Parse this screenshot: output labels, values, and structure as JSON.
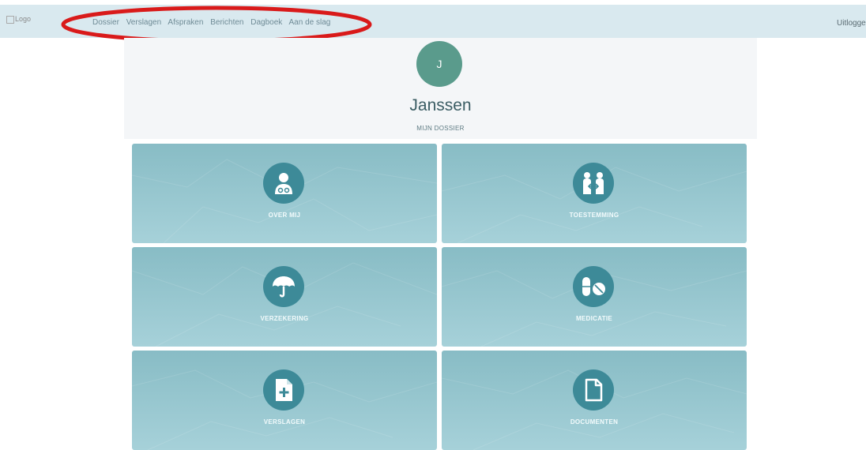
{
  "header": {
    "logo_alt": "Logo",
    "nav": [
      "Dossier",
      "Verslagen",
      "Afspraken",
      "Berichten",
      "Dagboek",
      "Aan de slag"
    ],
    "logout": "Uitloggen"
  },
  "profile": {
    "initial": "J",
    "name": "Janssen",
    "subtitle": "MIJN DOSSIER"
  },
  "tiles": [
    {
      "label": "OVER MIJ",
      "icon": "doctor-icon"
    },
    {
      "label": "TOESTEMMING",
      "icon": "consent-icon"
    },
    {
      "label": "VERZEKERING",
      "icon": "umbrella-icon"
    },
    {
      "label": "MEDICATIE",
      "icon": "pills-icon"
    },
    {
      "label": "VERSLAGEN",
      "icon": "medical-file-icon"
    },
    {
      "label": "DOCUMENTEN",
      "icon": "document-icon"
    }
  ],
  "colors": {
    "header_bg": "#d9e9ef",
    "avatar": "#5a9b8c",
    "tile": "#94c4cd",
    "icon_circle": "#3d8a98",
    "annotation": "#d91a1a"
  }
}
